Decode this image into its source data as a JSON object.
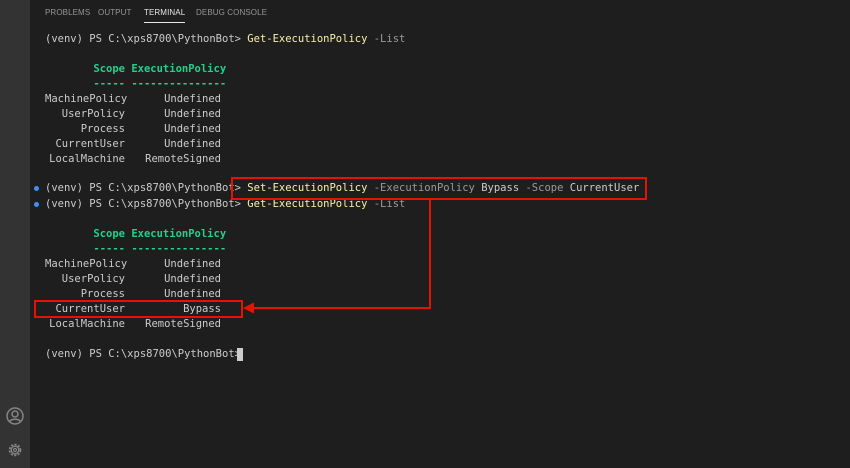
{
  "panel": {
    "tabs": [
      {
        "label": "PROBLEMS"
      },
      {
        "label": "OUTPUT"
      },
      {
        "label": "TERMINAL"
      },
      {
        "label": "DEBUG CONSOLE"
      }
    ]
  },
  "terminal": {
    "prompt": "(venv) PS C:\\xps8700\\PythonBot>",
    "cmd1": {
      "name": "Get-ExecutionPolicy",
      "param": "-List"
    },
    "table_header": {
      "scope": "Scope",
      "policy": "ExecutionPolicy"
    },
    "table_rule": {
      "scope": "-----",
      "policy": "---------------"
    },
    "table1": [
      {
        "scope": "MachinePolicy",
        "policy": "Undefined"
      },
      {
        "scope": "UserPolicy",
        "policy": "Undefined"
      },
      {
        "scope": "Process",
        "policy": "Undefined"
      },
      {
        "scope": "CurrentUser",
        "policy": "Undefined"
      },
      {
        "scope": "LocalMachine",
        "policy": "RemoteSigned"
      }
    ],
    "cmd2": {
      "name": "Set-ExecutionPolicy",
      "param1": "-ExecutionPolicy",
      "value1": "Bypass",
      "param2": "-Scope",
      "value2": "CurrentUser"
    },
    "cmd3": {
      "name": "Get-ExecutionPolicy",
      "param": "-List"
    },
    "table2": [
      {
        "scope": "MachinePolicy",
        "policy": "Undefined"
      },
      {
        "scope": "UserPolicy",
        "policy": "Undefined"
      },
      {
        "scope": "Process",
        "policy": "Undefined"
      },
      {
        "scope": "CurrentUser",
        "policy": "Bypass"
      },
      {
        "scope": "LocalMachine",
        "policy": "RemoteSigned"
      }
    ]
  },
  "icons": {
    "account": "account-icon",
    "settings": "gear-icon"
  },
  "colors": {
    "background": "#1e1e1e",
    "activitybar": "#333333",
    "command": "#f9f1a5",
    "parameter": "#9a9a9a",
    "header": "#23d18b",
    "decoration": "#3794ff",
    "highlight": "#e51400"
  }
}
